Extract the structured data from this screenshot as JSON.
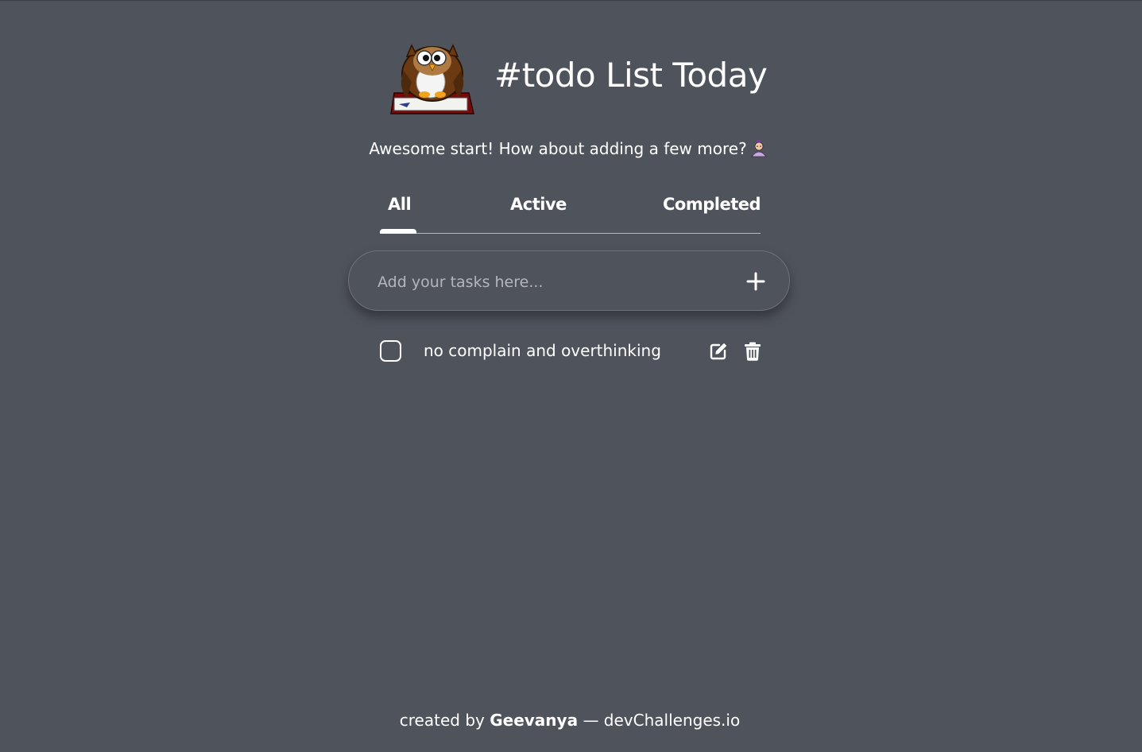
{
  "header": {
    "title": "#todo List Today",
    "logo_icon": "owl-on-book-icon"
  },
  "subtitle": {
    "text": "Awesome start! How about adding a few more?",
    "emoji_icon": "person-emoji-icon"
  },
  "tabs": [
    {
      "label": "All",
      "selected": true
    },
    {
      "label": "Active",
      "selected": false
    },
    {
      "label": "Completed",
      "selected": false
    }
  ],
  "input": {
    "placeholder": "Add your tasks here...",
    "value": "",
    "add_icon": "plus-icon"
  },
  "tasks": [
    {
      "text": "no complain and overthinking",
      "completed": false,
      "edit_icon": "edit-icon",
      "delete_icon": "trash-icon"
    }
  ],
  "footer": {
    "prefix": "created by",
    "author": "Geevanya",
    "separator": "—",
    "site": "devChallenges.io"
  },
  "colors": {
    "background": "#4f535c",
    "text": "#ffffff",
    "placeholder": "#b3b6bc",
    "divider": "#b8bbc1"
  }
}
